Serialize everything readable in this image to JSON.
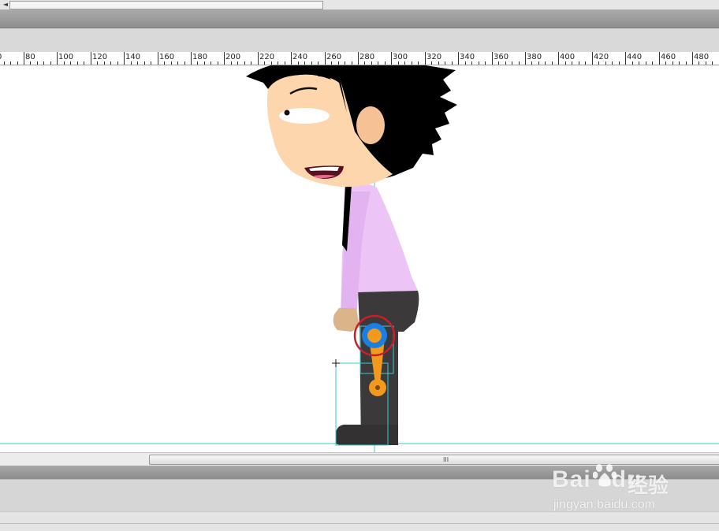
{
  "ruler": {
    "labels": [
      "80",
      "100",
      "120",
      "140",
      "160",
      "180",
      "200",
      "220",
      "240",
      "260",
      "280",
      "300",
      "320",
      "340",
      "360",
      "380",
      "400",
      "420",
      "440",
      "460",
      "480"
    ]
  },
  "watermark": {
    "brand_text": "Bai",
    "brand_text_2": "du",
    "product_text": "经验",
    "url_text": "jingyan.baidu.com"
  },
  "scrollbar": {
    "grip_glyph": "III",
    "left_arrow_glyph": "◄"
  },
  "colors": {
    "guide_line": "#3ec6d6",
    "bone": "#f39a1e",
    "joint_ring": "#c8202a",
    "joint_blue": "#1a7fe0",
    "skin": "#fdd6ad",
    "shirt": "#ecc4f6",
    "pants": "#3b393a",
    "hair": "#000000"
  }
}
